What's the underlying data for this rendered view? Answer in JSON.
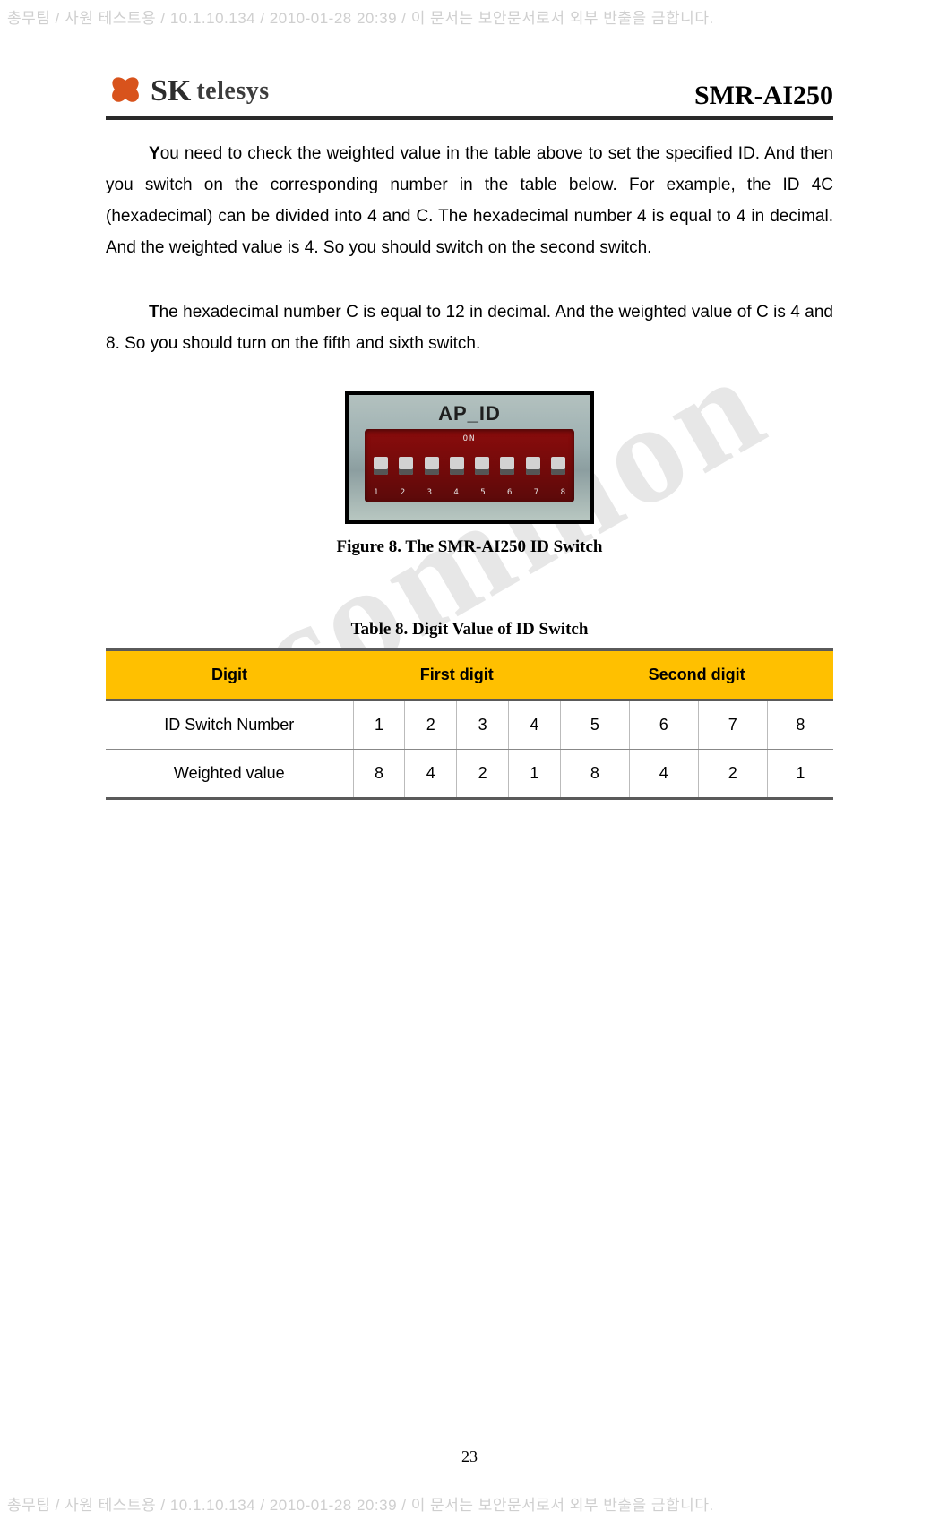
{
  "watermark": {
    "header": "총무팀 / 사원 테스트용 / 10.1.10.134 / 2010-01-28 20:39 /  이 문서는 보안문서로서 외부 반출을 금합니다.",
    "footer": "총무팀 / 사원 테스트용 / 10.1.10.134 / 2010-01-28 20:39 /  이 문서는 보안문서로서 외부 반출을 금합니다.",
    "big": "common"
  },
  "logo": {
    "text": "telesys"
  },
  "doc_title": "SMR-AI250",
  "paragraph1": {
    "first": "Y",
    "rest": "ou need to check the weighted value in the table above to set the specified ID. And then you switch on the corresponding number in the table below. For example, the ID 4C (hexadecimal) can be divided into 4 and C. The hexadecimal number 4 is equal to 4 in decimal. And the weighted value is 4. So you should switch on the second switch."
  },
  "paragraph2": {
    "first": "T",
    "rest": "he hexadecimal number C is equal to 12 in decimal. And the weighted value of C is 4 and 8. So you should turn on the fifth and sixth switch."
  },
  "figure": {
    "top_label": "AP_ID",
    "on_label": "ON",
    "nums": [
      "1",
      "2",
      "3",
      "4",
      "5",
      "6",
      "7",
      "8"
    ],
    "caption": "Figure 8. The SMR-AI250 ID Switch"
  },
  "table": {
    "caption": "Table 8. Digit Value of ID Switch",
    "headers": {
      "digit": "Digit",
      "first": "First digit",
      "second": "Second digit"
    },
    "rows": [
      {
        "label": "ID Switch Number",
        "values": [
          "1",
          "2",
          "3",
          "4",
          "5",
          "6",
          "7",
          "8"
        ]
      },
      {
        "label": "Weighted value",
        "values": [
          "8",
          "4",
          "2",
          "1",
          "8",
          "4",
          "2",
          "1"
        ]
      }
    ]
  },
  "page_number": "23"
}
